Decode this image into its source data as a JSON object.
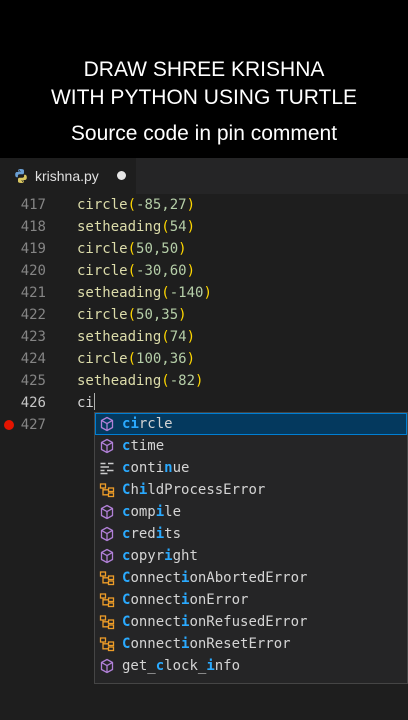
{
  "caption": {
    "line1": "DRAW SHREE KRISHNA",
    "line2": "WITH PYTHON USING TURTLE",
    "line3": "Source code in pin comment"
  },
  "tab": {
    "filename": "krishna.py",
    "icon": "python-icon",
    "modified": true
  },
  "code_lines": [
    {
      "n": "417",
      "fn": "circle",
      "args": "-85,27"
    },
    {
      "n": "418",
      "fn": "setheading",
      "args": "54"
    },
    {
      "n": "419",
      "fn": "circle",
      "args": "50,50"
    },
    {
      "n": "420",
      "fn": "circle",
      "args": "-30,60"
    },
    {
      "n": "421",
      "fn": "setheading",
      "args": "-140"
    },
    {
      "n": "422",
      "fn": "circle",
      "args": "50,35"
    },
    {
      "n": "423",
      "fn": "setheading",
      "args": "74"
    },
    {
      "n": "424",
      "fn": "circle",
      "args": "100,36"
    },
    {
      "n": "425",
      "fn": "setheading",
      "args": "-82"
    }
  ],
  "current_line": {
    "n": "426",
    "text": "ci"
  },
  "next_line": {
    "n": "427",
    "breakpoint": true
  },
  "suggestions": [
    {
      "label": "circle",
      "icon": "method-icon",
      "hl": [
        0,
        1
      ],
      "selected": true
    },
    {
      "label": "ctime",
      "icon": "method-icon",
      "hl": [
        0
      ]
    },
    {
      "label": "continue",
      "icon": "keyword-icon",
      "hl": [
        0,
        5
      ]
    },
    {
      "label": "ChildProcessError",
      "icon": "class-icon",
      "hl": [
        0,
        2
      ]
    },
    {
      "label": "compile",
      "icon": "method-icon",
      "hl": [
        0,
        4
      ]
    },
    {
      "label": "credits",
      "icon": "method-icon",
      "hl": [
        0,
        4
      ]
    },
    {
      "label": "copyright",
      "icon": "method-icon",
      "hl": [
        0,
        5
      ]
    },
    {
      "label": "ConnectionAbortedError",
      "icon": "class-icon",
      "hl": [
        0,
        7
      ]
    },
    {
      "label": "ConnectionError",
      "icon": "class-icon",
      "hl": [
        0,
        7
      ]
    },
    {
      "label": "ConnectionRefusedError",
      "icon": "class-icon",
      "hl": [
        0,
        7
      ]
    },
    {
      "label": "ConnectionResetError",
      "icon": "class-icon",
      "hl": [
        0,
        7
      ]
    },
    {
      "label": "get_clock_info",
      "icon": "method-icon",
      "hl": [
        4,
        10
      ]
    }
  ],
  "colors": {
    "method": "#b180d7",
    "class": "#ee9d28",
    "keyword": "#cccccc",
    "match": "#2aaaff"
  }
}
